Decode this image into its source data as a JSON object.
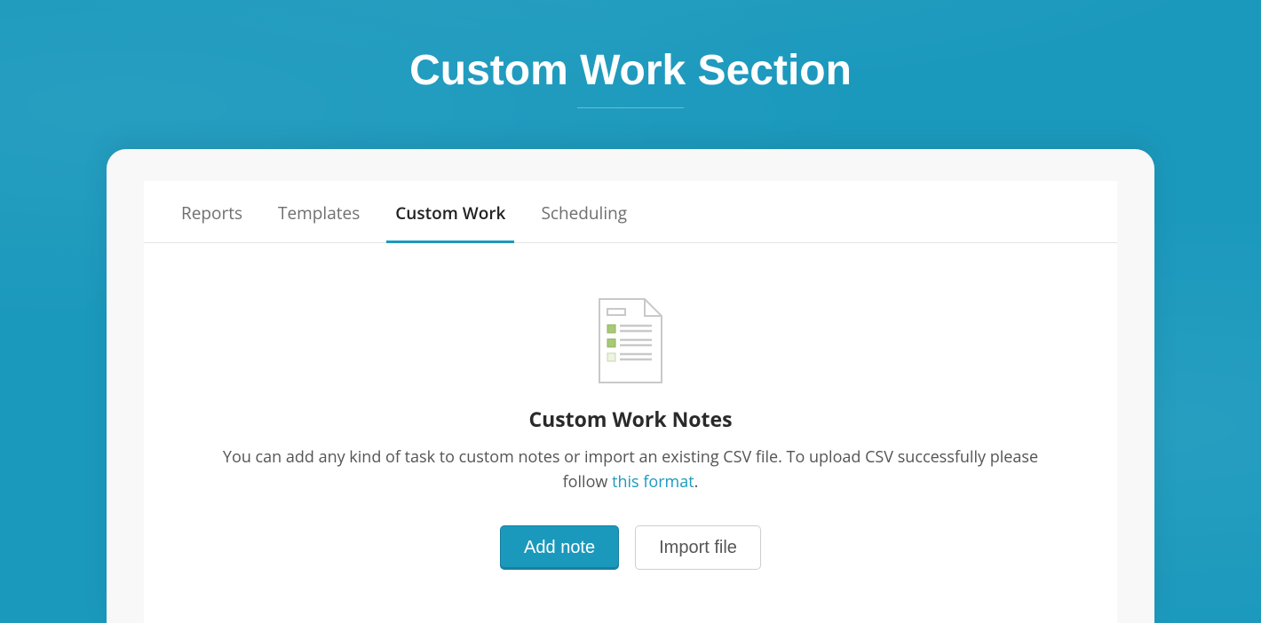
{
  "page": {
    "title": "Custom Work Section"
  },
  "tabs": [
    {
      "label": "Reports",
      "active": false
    },
    {
      "label": "Templates",
      "active": false
    },
    {
      "label": "Custom Work",
      "active": true
    },
    {
      "label": "Scheduling",
      "active": false
    }
  ],
  "empty": {
    "icon": "document-checklist-icon",
    "title": "Custom Work Notes",
    "desc_before": "You can add any kind of task to custom notes or import an existing CSV file. To upload CSV successfully please follow ",
    "link_text": "this format",
    "desc_after": "."
  },
  "buttons": {
    "primary": "Add note",
    "secondary": "Import file"
  },
  "colors": {
    "accent": "#1b99bd",
    "text": "#2a2a2a",
    "muted": "#6f6f6f"
  }
}
